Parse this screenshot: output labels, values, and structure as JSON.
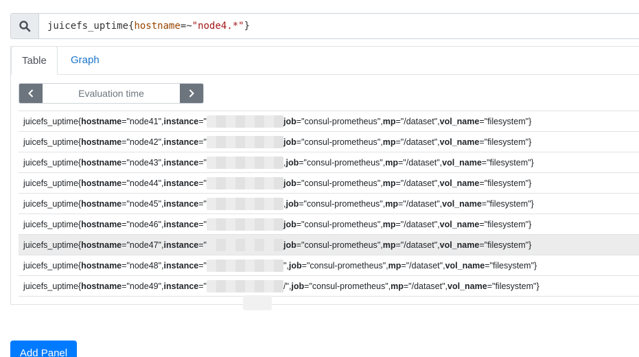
{
  "query": {
    "metric": "juicefs_uptime",
    "open_brace": "{",
    "label": "hostname",
    "operator": "=~",
    "value": "\"node4.*\"",
    "close_brace": "}"
  },
  "tabs": [
    {
      "label": "Table",
      "active": true
    },
    {
      "label": "Graph",
      "active": false
    }
  ],
  "evaluation": {
    "placeholder": "Evaluation time"
  },
  "rows": [
    {
      "metric": "juicefs_uptime",
      "hostname": "node41",
      "sep_after_instance": "",
      "job": "consul-prometheus",
      "mp": "/dataset",
      "vol_name": "filesystem"
    },
    {
      "metric": "juicefs_uptime",
      "hostname": "node42",
      "sep_after_instance": "",
      "job": "consul-prometheus",
      "mp": "/dataset",
      "vol_name": "filesystem"
    },
    {
      "metric": "juicefs_uptime",
      "hostname": "node43",
      "sep_after_instance": ", ",
      "job": "consul-prometheus",
      "mp": "/dataset",
      "vol_name": "filesystem"
    },
    {
      "metric": "juicefs_uptime",
      "hostname": "node44",
      "sep_after_instance": "",
      "job": "consul-prometheus",
      "mp": "/dataset",
      "vol_name": "filesystem"
    },
    {
      "metric": "juicefs_uptime",
      "hostname": "node45",
      "sep_after_instance": ", ",
      "job": "consul-prometheus",
      "mp": "/dataset",
      "vol_name": "filesystem"
    },
    {
      "metric": "juicefs_uptime",
      "hostname": "node46",
      "sep_after_instance": "",
      "job": "consul-prometheus",
      "mp": "/dataset",
      "vol_name": "filesystem"
    },
    {
      "metric": "juicefs_uptime",
      "hostname": "node47",
      "sep_after_instance": "",
      "job": "consul-prometheus",
      "mp": "/dataset",
      "vol_name": "filesystem"
    },
    {
      "metric": "juicefs_uptime",
      "hostname": "node48",
      "sep_after_instance": "\", ",
      "job": "consul-prometheus",
      "mp": "/dataset",
      "vol_name": "filesystem"
    },
    {
      "metric": "juicefs_uptime",
      "hostname": "node49",
      "sep_after_instance": "/\", ",
      "job": "consul-prometheus",
      "mp": "/dataset",
      "vol_name": "filesystem"
    }
  ],
  "labels": {
    "hostname": "hostname",
    "instance": "instance",
    "job": "job",
    "mp": "mp",
    "vol_name": "vol_name"
  },
  "actions": {
    "add_panel": "Add Panel"
  },
  "colors": {
    "primary": "#007bff",
    "secondary": "#6c757d",
    "link": "#1a73c8",
    "label_name": "#994500",
    "string": "#a31515"
  },
  "icons": {
    "search": "search-icon",
    "prev": "chevron-left-icon",
    "next": "chevron-right-icon"
  }
}
